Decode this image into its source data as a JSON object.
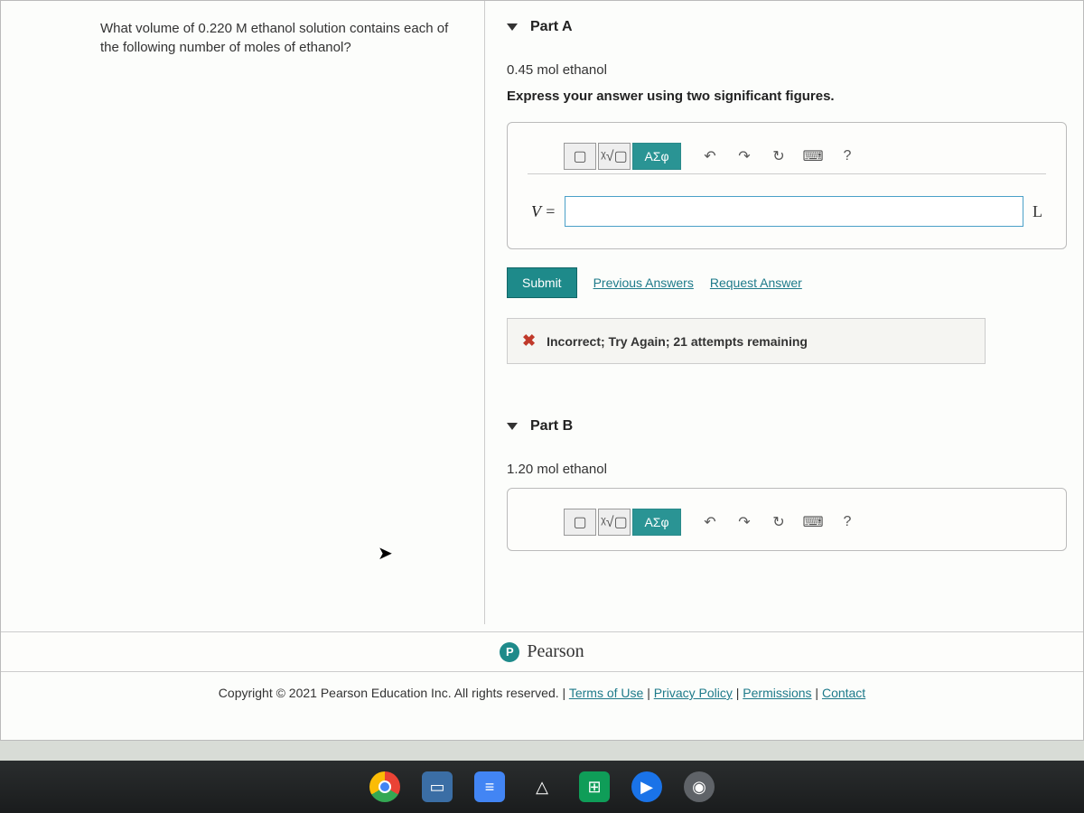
{
  "question": "What volume of 0.220 M ethanol solution contains each of the following number of moles of ethanol?",
  "partA": {
    "title": "Part A",
    "prompt": "0.45 mol ethanol",
    "instruction": "Express your answer using two significant figures.",
    "toolbar": {
      "template": "▢",
      "sqrt": "ᵡ√▢",
      "greek": "ΑΣφ",
      "undo": "↶",
      "redo": "↷",
      "reset": "↻",
      "keyboard": "⌨",
      "help": "?"
    },
    "variable": "V =",
    "input_value": "",
    "unit": "L",
    "submit": "Submit",
    "prev": "Previous Answers",
    "request": "Request Answer",
    "feedback": "Incorrect; Try Again; 21 attempts remaining"
  },
  "partB": {
    "title": "Part B",
    "prompt": "1.20 mol ethanol",
    "toolbar": {
      "template": "▢",
      "sqrt": "ᵡ√▢",
      "greek": "ΑΣφ",
      "undo": "↶",
      "redo": "↷",
      "reset": "↻",
      "keyboard": "⌨",
      "help": "?"
    }
  },
  "brand": {
    "p": "P",
    "name": "Pearson"
  },
  "copyright": {
    "text": "Copyright © 2021 Pearson Education Inc. All rights reserved.",
    "sep": " | ",
    "links": [
      "Terms of Use",
      "Privacy Policy",
      "Permissions",
      "Contact"
    ]
  }
}
